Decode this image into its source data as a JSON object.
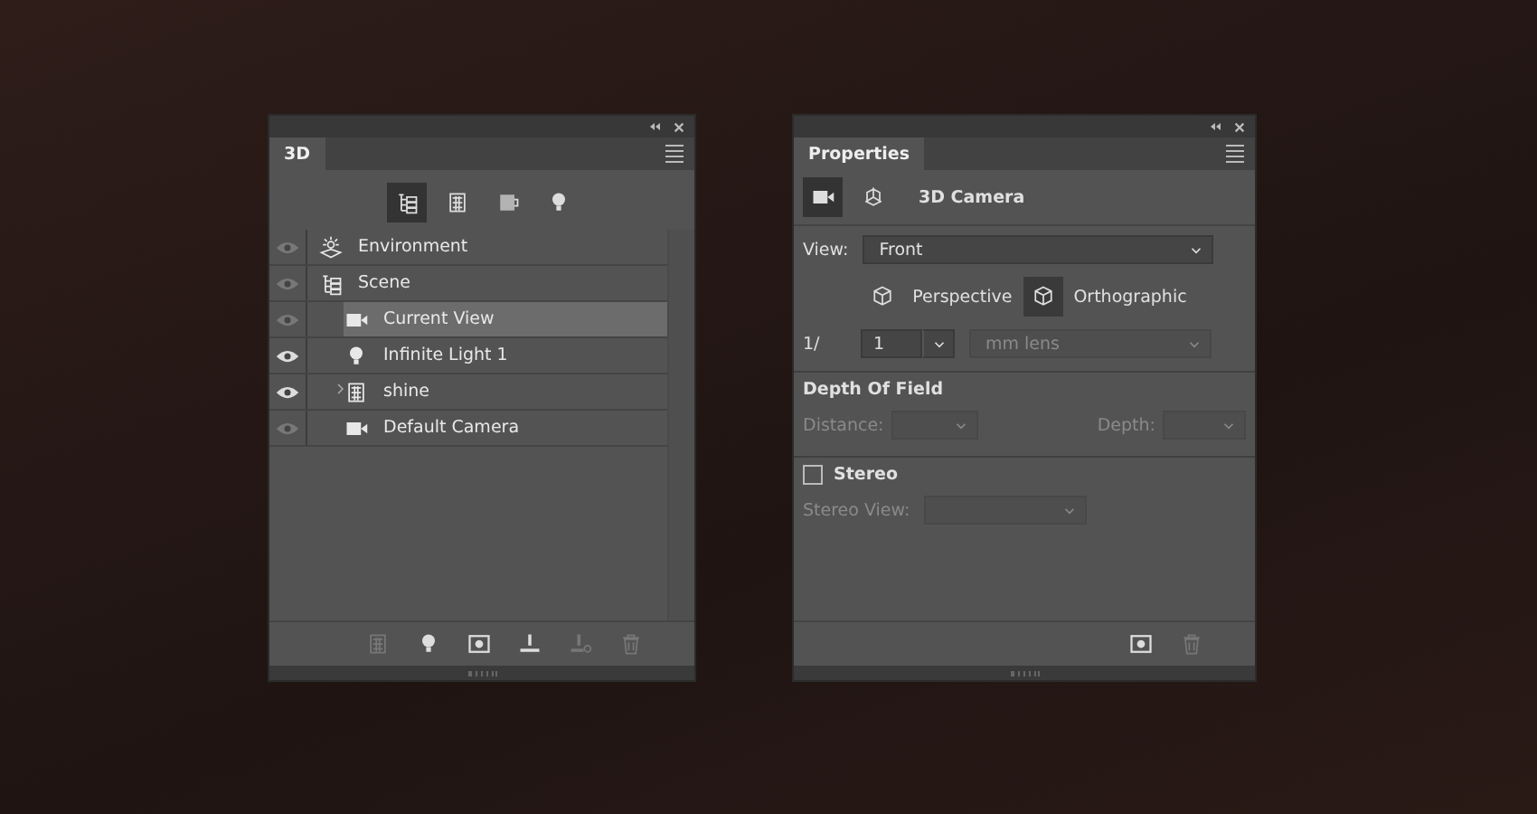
{
  "panel_3d": {
    "title": "3D",
    "filters": [
      {
        "kind": "scene",
        "selected": true
      },
      {
        "kind": "mesh",
        "selected": false
      },
      {
        "kind": "material",
        "selected": false
      },
      {
        "kind": "light",
        "selected": false
      }
    ],
    "layers": [
      {
        "name": "Environment",
        "kind": "environment",
        "visible": false,
        "selected": false
      },
      {
        "name": "Scene",
        "kind": "scene",
        "visible": false,
        "selected": false,
        "children": [
          {
            "name": "Current View",
            "kind": "camera",
            "visible": false,
            "selected": true
          },
          {
            "name": "Infinite Light 1",
            "kind": "light",
            "visible": true,
            "selected": false
          },
          {
            "name": "shine",
            "kind": "mesh",
            "visible": true,
            "selected": false,
            "expanded": false
          },
          {
            "name": "Default Camera",
            "kind": "camera",
            "visible": false,
            "selected": false
          }
        ]
      }
    ],
    "toolbar": [
      {
        "kind": "mesh",
        "disabled": true
      },
      {
        "kind": "light",
        "disabled": false
      },
      {
        "kind": "render",
        "disabled": false
      },
      {
        "kind": "ground",
        "disabled": false
      },
      {
        "kind": "ground-drop",
        "disabled": true
      },
      {
        "kind": "trash",
        "disabled": true
      }
    ]
  },
  "properties": {
    "title": "Properties",
    "modes": [
      {
        "kind": "camera",
        "selected": true
      },
      {
        "kind": "coordinates",
        "selected": false
      }
    ],
    "heading": "3D Camera",
    "view": {
      "label": "View:",
      "value": "Front"
    },
    "projections": [
      {
        "label": "Perspective",
        "selected": false
      },
      {
        "label": "Orthographic",
        "selected": true
      }
    ],
    "zoom": {
      "label": "1/",
      "value": "1",
      "lens": "mm lens"
    },
    "depth_of_field": {
      "title": "Depth Of Field",
      "distance_label": "Distance:",
      "depth_label": "Depth:"
    },
    "stereo": {
      "label": "Stereo",
      "checked": false,
      "view_label": "Stereo View:"
    },
    "toolbar": [
      {
        "kind": "render",
        "disabled": false
      },
      {
        "kind": "trash",
        "disabled": true
      }
    ]
  }
}
